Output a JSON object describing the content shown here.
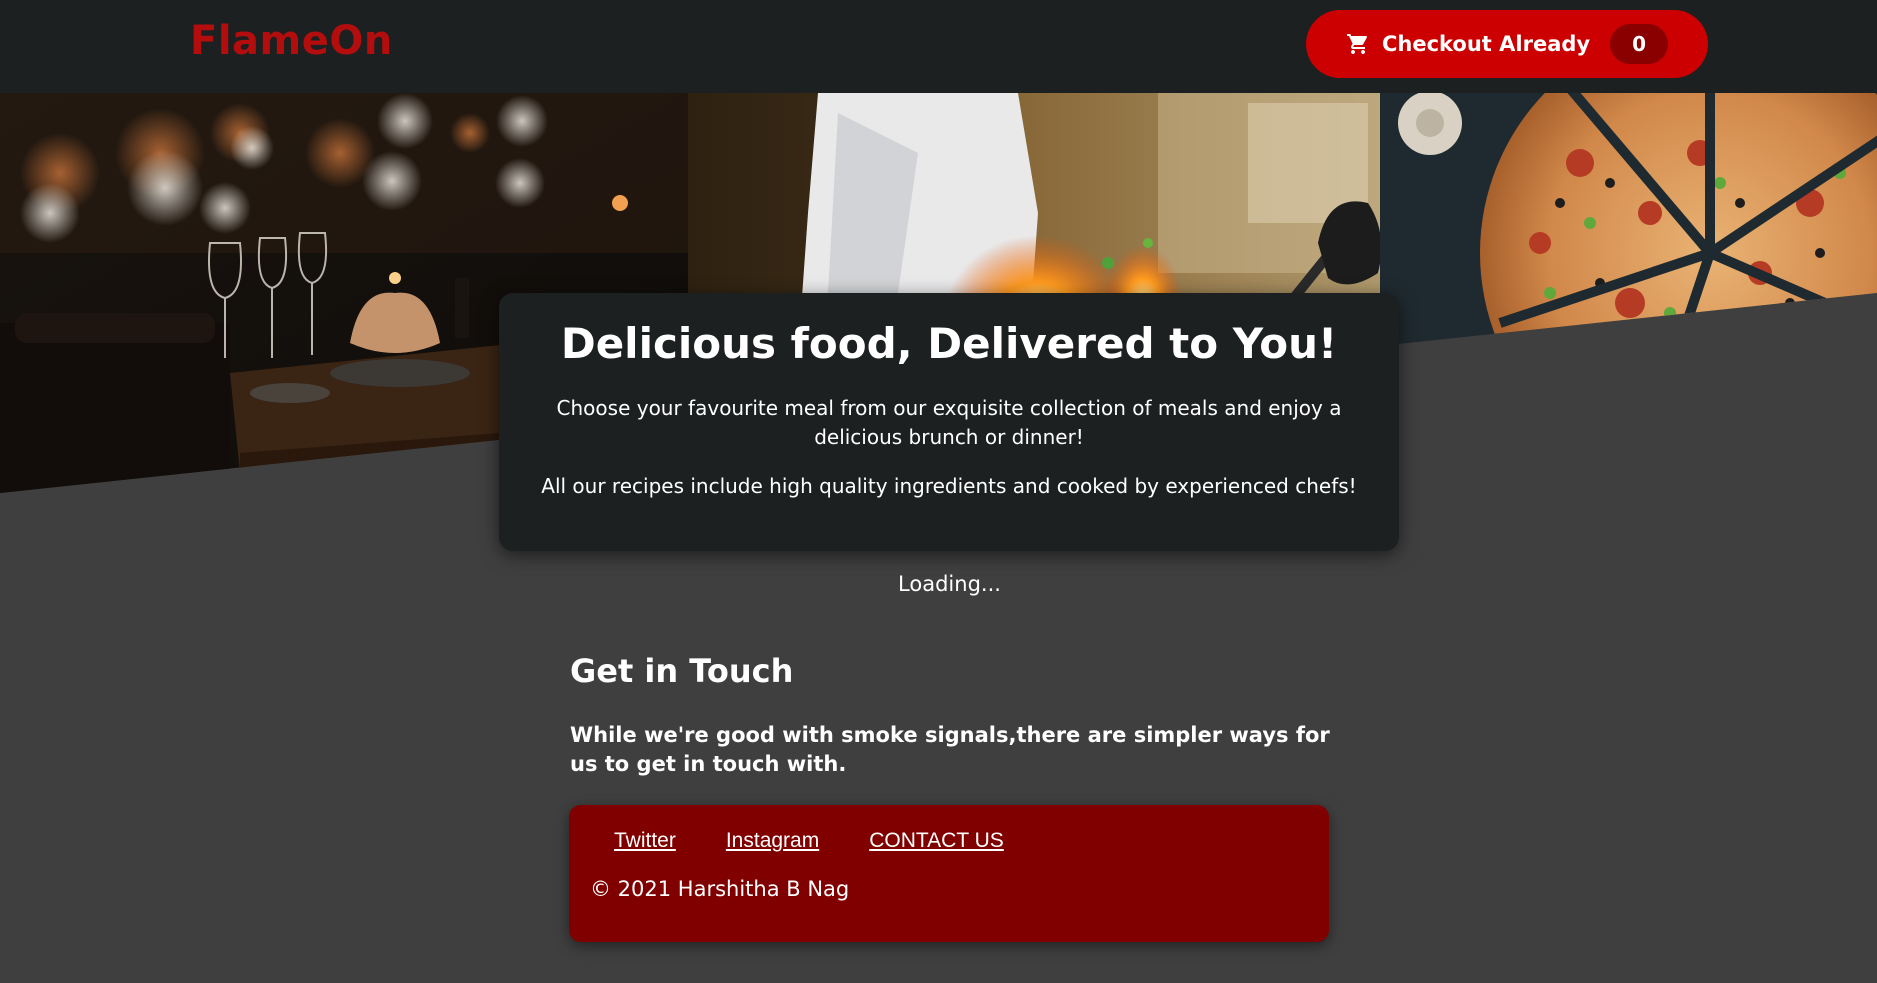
{
  "header": {
    "logo": "FlameOn",
    "checkout_label": "Checkout Already",
    "cart_count": "0",
    "cart_icon": "cart-icon"
  },
  "hero": {
    "panels": [
      "restaurant-table-image",
      "chef-flambe-image",
      "pizza-image"
    ]
  },
  "card": {
    "title": "Delicious food, Delivered to You!",
    "paragraph1": "Choose your favourite meal from our exquisite collection of meals and enjoy a delicious brunch or dinner!",
    "paragraph2": "All our recipes include high quality ingredients and cooked by experienced chefs!"
  },
  "status": {
    "loading": "Loading..."
  },
  "contact": {
    "title": "Get in Touch",
    "text": "While we're good with smoke signals,there are simpler ways for us to get in touch with."
  },
  "footer": {
    "links": [
      "Twitter",
      "Instagram",
      "CONTACT US"
    ],
    "copyright": "© 2021 Harshitha B Nag"
  },
  "colors": {
    "header_bg": "#1c2021",
    "page_bg": "#3f3f3f",
    "accent_red": "#cc0000",
    "logo_red": "#b30d0d",
    "footer_red": "#800000"
  }
}
